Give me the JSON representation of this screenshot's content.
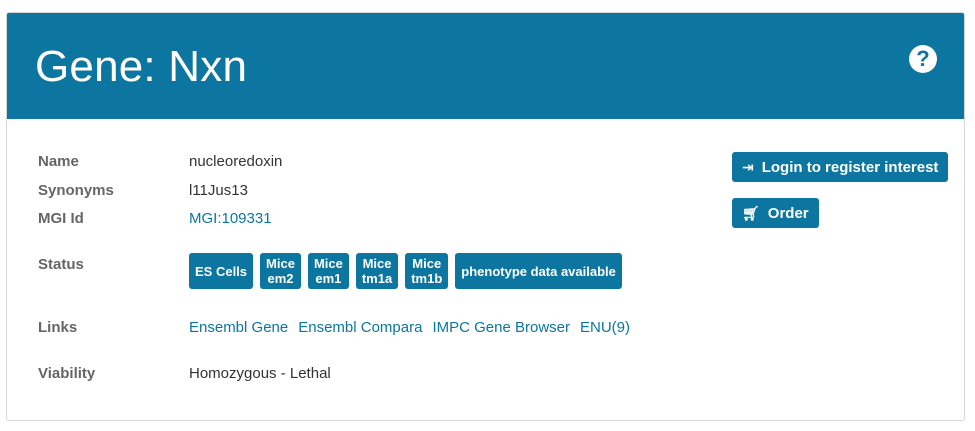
{
  "header": {
    "title": "Gene: Nxn",
    "help_icon": "?"
  },
  "fields": {
    "name_label": "Name",
    "name_value": "nucleoredoxin",
    "synonyms_label": "Synonyms",
    "synonyms_value": "l11Jus13",
    "mgi_label": "MGI Id",
    "mgi_value": "MGI:109331",
    "status_label": "Status",
    "links_label": "Links",
    "viability_label": "Viability",
    "viability_value": "Homozygous - Lethal"
  },
  "status_badges": [
    {
      "line1": "ES Cells",
      "line2": ""
    },
    {
      "line1": "Mice",
      "line2": "em2"
    },
    {
      "line1": "Mice",
      "line2": "em1"
    },
    {
      "line1": "Mice",
      "line2": "tm1a"
    },
    {
      "line1": "Mice",
      "line2": "tm1b"
    },
    {
      "line1": "phenotype data available",
      "line2": ""
    }
  ],
  "links": [
    "Ensembl Gene",
    "Ensembl Compara",
    "IMPC Gene Browser",
    "ENU(9)"
  ],
  "actions": {
    "register_label": "Login to register interest",
    "register_icon": "login-icon",
    "order_label": "Order",
    "order_icon": "cart-icon"
  },
  "colors": {
    "primary": "#0d76a0",
    "label_gray": "#666666"
  }
}
